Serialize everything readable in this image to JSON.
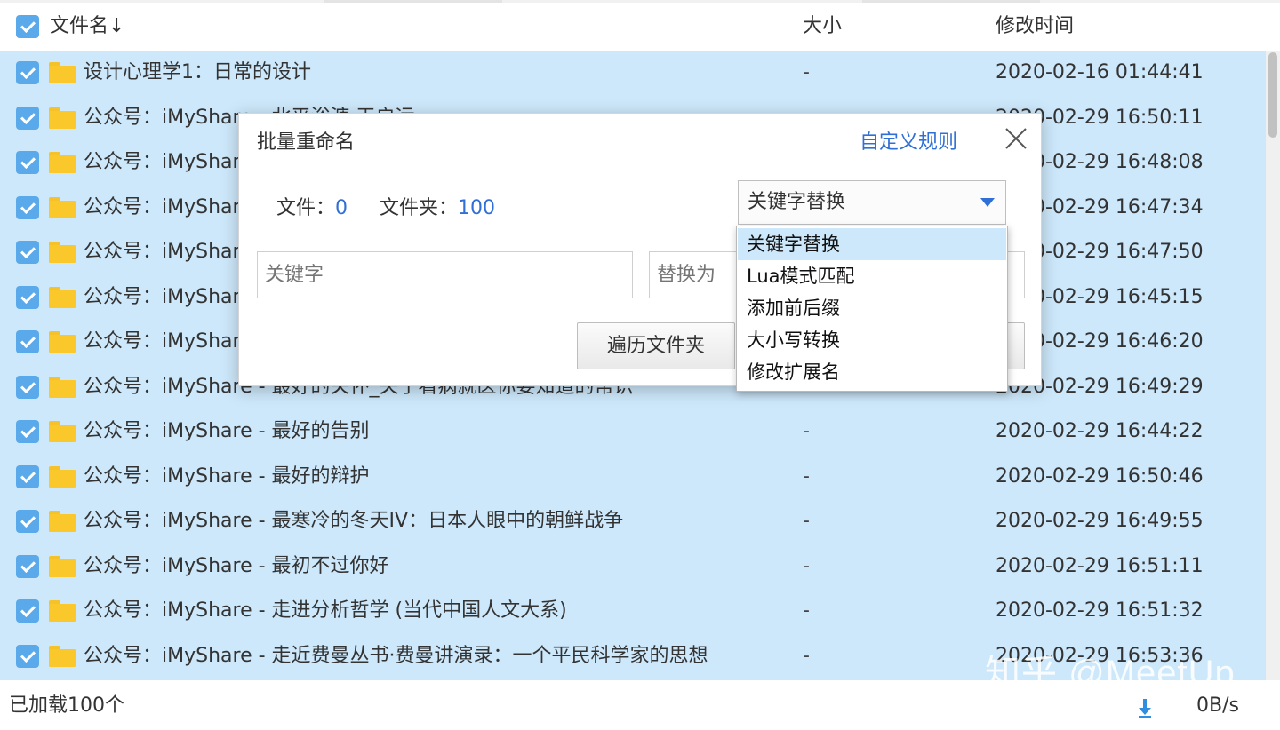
{
  "header": {
    "name_col": "文件名",
    "sort_arrow": "↓",
    "size_col": "大小",
    "time_col": "修改时间"
  },
  "rows": [
    {
      "name": "设计心理学1：日常的设计",
      "size": "-",
      "time": "2020-02-16 01:44:41"
    },
    {
      "name": "公众号：iMyShare - 北平浴溏 天启运",
      "size": "-",
      "time": "2020-02-29 16:50:11"
    },
    {
      "name": "公众号：iMyShare",
      "size": "-",
      "time": "2020-02-29 16:48:08"
    },
    {
      "name": "公众号：iMyShare",
      "size": "-",
      "time": "2020-02-29 16:47:34"
    },
    {
      "name": "公众号：iMyShare",
      "size": "-",
      "time": "2020-02-29 16:47:50"
    },
    {
      "name": "公众号：iMyShare",
      "size": "-",
      "time": "2020-02-29 16:45:15"
    },
    {
      "name": "公众号：iMyShare",
      "size": "-",
      "time": "2020-02-29 16:46:20"
    },
    {
      "name": "公众号：iMyShare - 最好的关怀_关于看病就医你要知道的常识",
      "size": "-",
      "time": "2020-02-29 16:49:29"
    },
    {
      "name": "公众号：iMyShare - 最好的告别",
      "size": "-",
      "time": "2020-02-29 16:44:22"
    },
    {
      "name": "公众号：iMyShare - 最好的辩护",
      "size": "-",
      "time": "2020-02-29 16:50:46"
    },
    {
      "name": "公众号：iMyShare - 最寒冷的冬天IV：日本人眼中的朝鲜战争",
      "size": "-",
      "time": "2020-02-29 16:49:55"
    },
    {
      "name": "公众号：iMyShare - 最初不过你好",
      "size": "-",
      "time": "2020-02-29 16:51:11"
    },
    {
      "name": "公众号：iMyShare - 走进分析哲学 (当代中国人文大系)",
      "size": "-",
      "time": "2020-02-29 16:51:32"
    },
    {
      "name": "公众号：iMyShare - 走近费曼丛书·费曼讲演录：一个平民科学家的思想",
      "size": "-",
      "time": "2020-02-29 16:53:36"
    }
  ],
  "footer": {
    "loaded": "已加载100个",
    "speed": "0B/s"
  },
  "watermark": "知乎 @MeetUp",
  "dialog": {
    "title": "批量重命名",
    "custom_rule": "自定义规则",
    "file_label": "文件：",
    "file_count": "0",
    "folder_label": "文件夹：",
    "folder_count": "100",
    "mode_selected": "关键字替换",
    "keyword_placeholder": "关键字",
    "replace_placeholder": "替换为",
    "traverse_button": "遍历文件夹"
  },
  "dropdown": {
    "options": [
      "关键字替换",
      "Lua模式匹配",
      "添加前后缀",
      "大小写转换",
      "修改扩展名"
    ],
    "highlighted_index": 0
  },
  "colors": {
    "selection": "#cde8fb",
    "checkbox": "#5aa9ea",
    "folder": "#fbc82c",
    "link": "#2f6fd6"
  }
}
